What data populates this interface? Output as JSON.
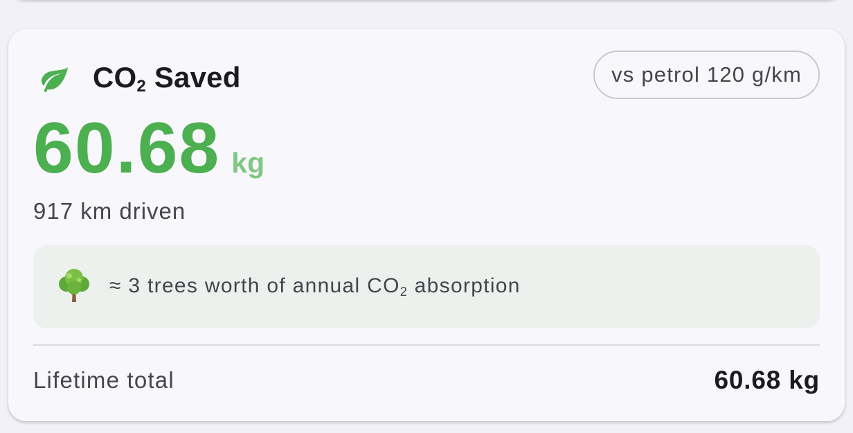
{
  "card": {
    "title_main": "CO",
    "title_sub": "2",
    "title_rest": " Saved",
    "comparison_chip": "vs petrol 120 g/km",
    "amount": "60.68",
    "unit": "kg",
    "distance": "917 km driven",
    "equivalence": {
      "icon": "tree-icon",
      "text_before": "≈ 3 trees worth of annual CO",
      "text_sub": "2",
      "text_after": " absorption"
    },
    "lifetime": {
      "label": "Lifetime total",
      "value": "60.68 kg"
    },
    "icon": "leaf-icon"
  },
  "colors": {
    "accent": "#4caf50",
    "accent_light": "#81c784",
    "card_bg": "#f8f7fc",
    "equivalence_bg": "#ecf1ee"
  }
}
